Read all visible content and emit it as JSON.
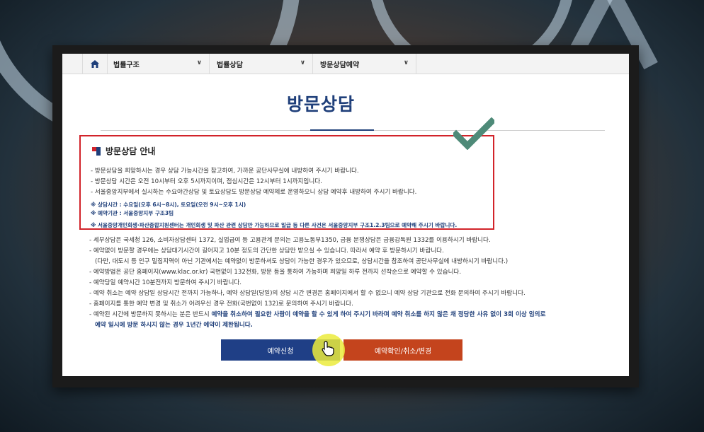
{
  "breadcrumb": {
    "home_icon": "home-icon",
    "items": [
      {
        "label": "법률구조"
      },
      {
        "label": "법률상담"
      },
      {
        "label": "방문상담예약"
      }
    ]
  },
  "page": {
    "title": "방문상담"
  },
  "notice": {
    "heading": "방문상담 안내",
    "lines": [
      "- 방문상담을 희망하시는 경우 상담 가능시간을 참고하여, 가까운 공단사무실에 내방하여 주시기 바랍니다.",
      "- 방문상담 시간은 오전 10시부터 오후 5시까지이며, 점심시간은 12시부터 1시까지입니다.",
      "- 서울중앙지부에서 실시하는 수요야간상담 및 토요상담도 방문상담 예약제로 운영하오니 상담 예약후 내방하여 주시기 바랍니다."
    ],
    "hours": "※ 상담시간 : 수요일(오후 6시~8시), 토요일(오전 9시~오후 1시)",
    "agency": "※ 예약기관 : 서울중앙지부 구조3팀",
    "center": "※ 서울중앙개인회생·파산종합지원센터는 개인회생 및 파산 관련 상담만 가능하므로 일급 등 다른 사건은 서울중앙지부 구조1.2.3팀으로 예약해 주시기 바랍니다."
  },
  "body_lines": [
    "- 세무상담은 국세청 126, 소비자상담센터 1372, 실업급여 등 고용관계 문의는 고용노동부1350, 금융 분쟁상담은 금융감독원 1332를 이용하시기 바랍니다.",
    "- 예약없이 방문할 경우에는 상담대기시간이 길어지고 10분 정도의 간단한 상담만 받으실 수 있습니다. 따라서 예약 후 방문하시기 바랍니다.",
    "(다만, 대도시 등 인구 밀집지역이 아닌 기관에서는 예약없이 방문하셔도 상담이 가능한 경우가 있으므로, 상담시간을 참조하여 공단사무실에 내방하시기 바랍니다.)",
    "- 예약방법은 공단 홈페이지(www.klac.or.kr) 국번없이 132전화, 방문 등을 통하여 가능하며 희망일 하루 전까지 선착순으로 예약할 수 있습니다.",
    "- 예약당일 예약시간 10분전까지 방문하여 주시기 바랍니다.",
    "- 예약 취소는 예약 상담일 상담시간 전까지 가능하나, 예약 상담일(당일)의 상담 시간 변경은 홈페이지에서 할 수 없으니 예약 상담 기관으로 전화 문의하여 주시기 바랍니다.",
    "- 홈페이지를 통한 예약 변경 및 취소가 어려우신 경우 전화(국번없이 132)로 문의하여 주시기 바랍니다."
  ],
  "warning": {
    "prefix": "- 예약된 시간에 방문하지 못하시는 분은 반드시 ",
    "bold1": "예약을 취소하여 필요한 사람이 예약을 할 수 있게 하여 주시기 바라며 예약 취소를 하지 않은 채 정당한 사유 없이 3회 이상 임의로",
    "bold2": "예약 일시에 방문 하시지 않는 경우 1년간 예약이 제한됩니다."
  },
  "buttons": {
    "reserve": "예약신청",
    "check": "예약확인/취소/변경"
  },
  "colors": {
    "navy": "#1f3f86",
    "orange": "#c4441d",
    "red_box": "#d2232a",
    "check": "#4e8a78"
  },
  "icons": {
    "check": "checkmark-icon",
    "cursor": "hand-pointer-icon"
  }
}
